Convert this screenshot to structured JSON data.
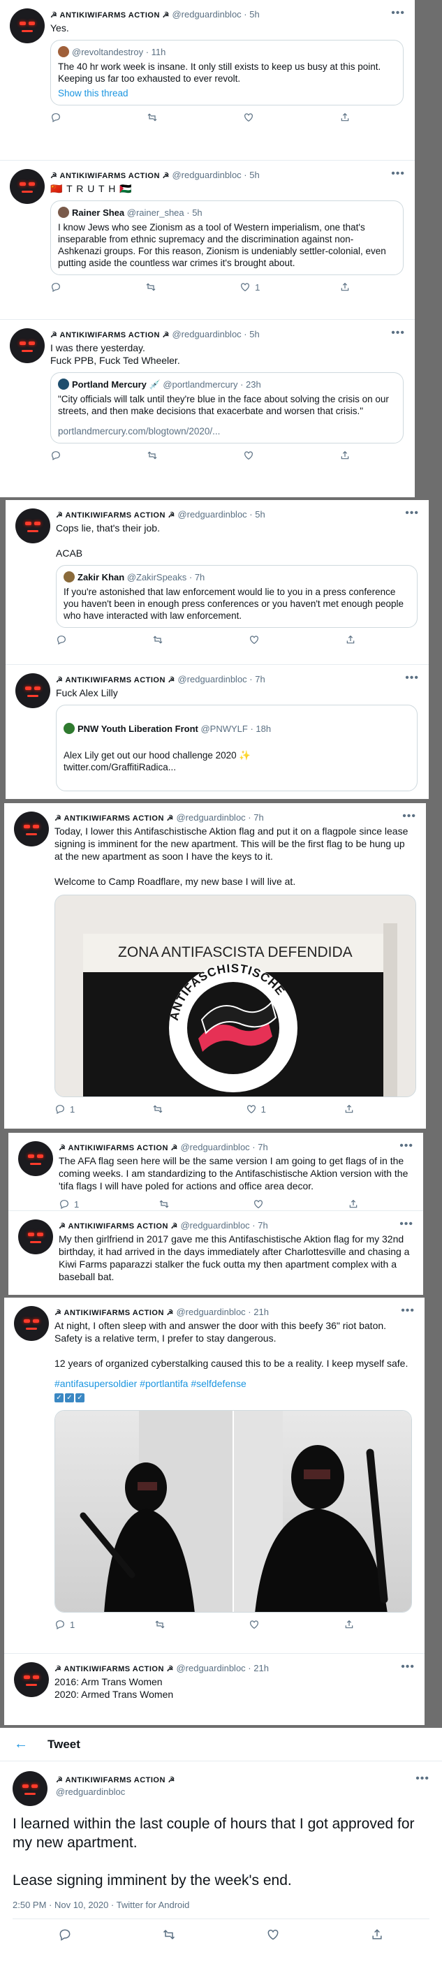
{
  "common": {
    "display_name": "☭ ANTIKIWIFARMS ACTION ☭",
    "handle": "@redguardinbloc",
    "separator": "·",
    "more": "•••"
  },
  "tweets": [
    {
      "time": "5h",
      "text": "Yes.",
      "quote": {
        "name": "",
        "handle": "@revoltandestroy",
        "time": "11h",
        "text": "The 40 hr work week is insane. It only still exists to keep us busy at this point. Keeping us far too exhausted to ever revolt.",
        "extra": "Show this thread"
      },
      "counts": {
        "reply": "",
        "retweet": "",
        "like": "",
        "share": ""
      }
    },
    {
      "time": "5h",
      "text": "🇨🇳 T R U T H 🇵🇸",
      "quote": {
        "name": "Rainer Shea",
        "handle": "@rainer_shea",
        "time": "5h",
        "text": "I know Jews who see Zionism as a tool of Western imperialism, one that's inseparable from ethnic supremacy and the discrimination against non-Ashkenazi groups. For this reason, Zionism is undeniably settler-colonial, even putting aside the countless war crimes it's brought about."
      },
      "counts": {
        "reply": "",
        "retweet": "",
        "like": "1",
        "share": ""
      }
    },
    {
      "time": "5h",
      "text": "I was there yesterday.\nFuck PPB, Fuck Ted Wheeler.",
      "quote": {
        "name": "Portland Mercury 💉",
        "handle": "@portlandmercury",
        "time": "23h",
        "text": "\"City officials will talk until they're blue in the face about solving the crisis on our streets, and then make decisions that exacerbate and worsen that crisis.\"",
        "extra": "portlandmercury.com/blogtown/2020/..."
      },
      "counts": {
        "reply": "",
        "retweet": "",
        "like": "",
        "share": ""
      }
    },
    {
      "time": "5h",
      "text": "Cops lie, that's their job.\n\nACAB",
      "quote": {
        "name": "Zakir Khan",
        "handle": "@ZakirSpeaks",
        "time": "7h",
        "text": "If you're astonished that law enforcement would lie to you in a press conference you haven't been in enough press conferences or you haven't met enough people who have interacted with law enforcement."
      },
      "counts": {
        "reply": "",
        "retweet": "",
        "like": "",
        "share": ""
      }
    },
    {
      "time": "7h",
      "text": "Fuck Alex Lilly",
      "quote": {
        "name": "PNW Youth Liberation Front",
        "handle": "@PNWYLF",
        "time": "18h",
        "text": "Alex Lily get out our hood challenge  2020 ✨\ntwitter.com/GraffitiRadica..."
      },
      "counts": {
        "reply": "",
        "retweet": "",
        "like": "",
        "share": ""
      }
    },
    {
      "time": "7h",
      "text": "Today, I lower this Antifaschistische Aktion flag and put it on a flagpole since lease signing is imminent for the new apartment. This will be the first flag to be hung up at the new apartment as soon I have the keys to it.\n\nWelcome to Camp Roadflare, my new base I will live at.",
      "image": {
        "banner": "ZONA ANTIFASCISTA DEFENDIDA",
        "ring_text": "ANTIFASCHISTISCHE"
      },
      "counts": {
        "reply": "1",
        "retweet": "",
        "like": "1",
        "share": ""
      }
    },
    {
      "time": "7h",
      "text": "The AFA flag seen here will be the same version I am going to get flags of in the coming weeks. I am standardizing to the Antifaschistische Aktion version with the 'tifa flags I will have poled for actions and office area decor.",
      "counts": {
        "reply": "1",
        "retweet": "",
        "like": "",
        "share": ""
      }
    },
    {
      "time": "7h",
      "text": "My then girlfriend in 2017 gave me this Antifaschistische Aktion flag for my 32nd birthday, it had arrived in the days immediately after Charlottesville and chasing a Kiwi Farms paparazzi stalker the fuck outta my then apartment complex with a baseball bat.",
      "counts": {
        "reply": "",
        "retweet": "",
        "like": "",
        "share": ""
      }
    },
    {
      "time": "21h",
      "text": "At night, I often sleep with and  answer the door with this beefy 36\" riot baton. Safety is a relative term, I prefer to stay dangerous.\n\n12 years of organized cyberstalking caused this to be a reality. I keep myself safe.",
      "hashtags": "#antifasupersoldier #portlantifa #selfdefense",
      "counts": {
        "reply": "1",
        "retweet": "",
        "like": "",
        "share": ""
      }
    },
    {
      "time": "21h",
      "text": "2016: Arm Trans Women\n2020: Armed Trans Women"
    }
  ],
  "detail": {
    "header_title": "Tweet",
    "text": "I learned within the last couple of hours that I got approved for my new apartment.\n\nLease signing imminent by the week's end.",
    "meta": "2:50 PM · Nov 10, 2020 · Twitter for Android"
  },
  "colors": {
    "accent": "#1b95e0",
    "muted": "#5b7083",
    "border": "#cfd9de"
  }
}
